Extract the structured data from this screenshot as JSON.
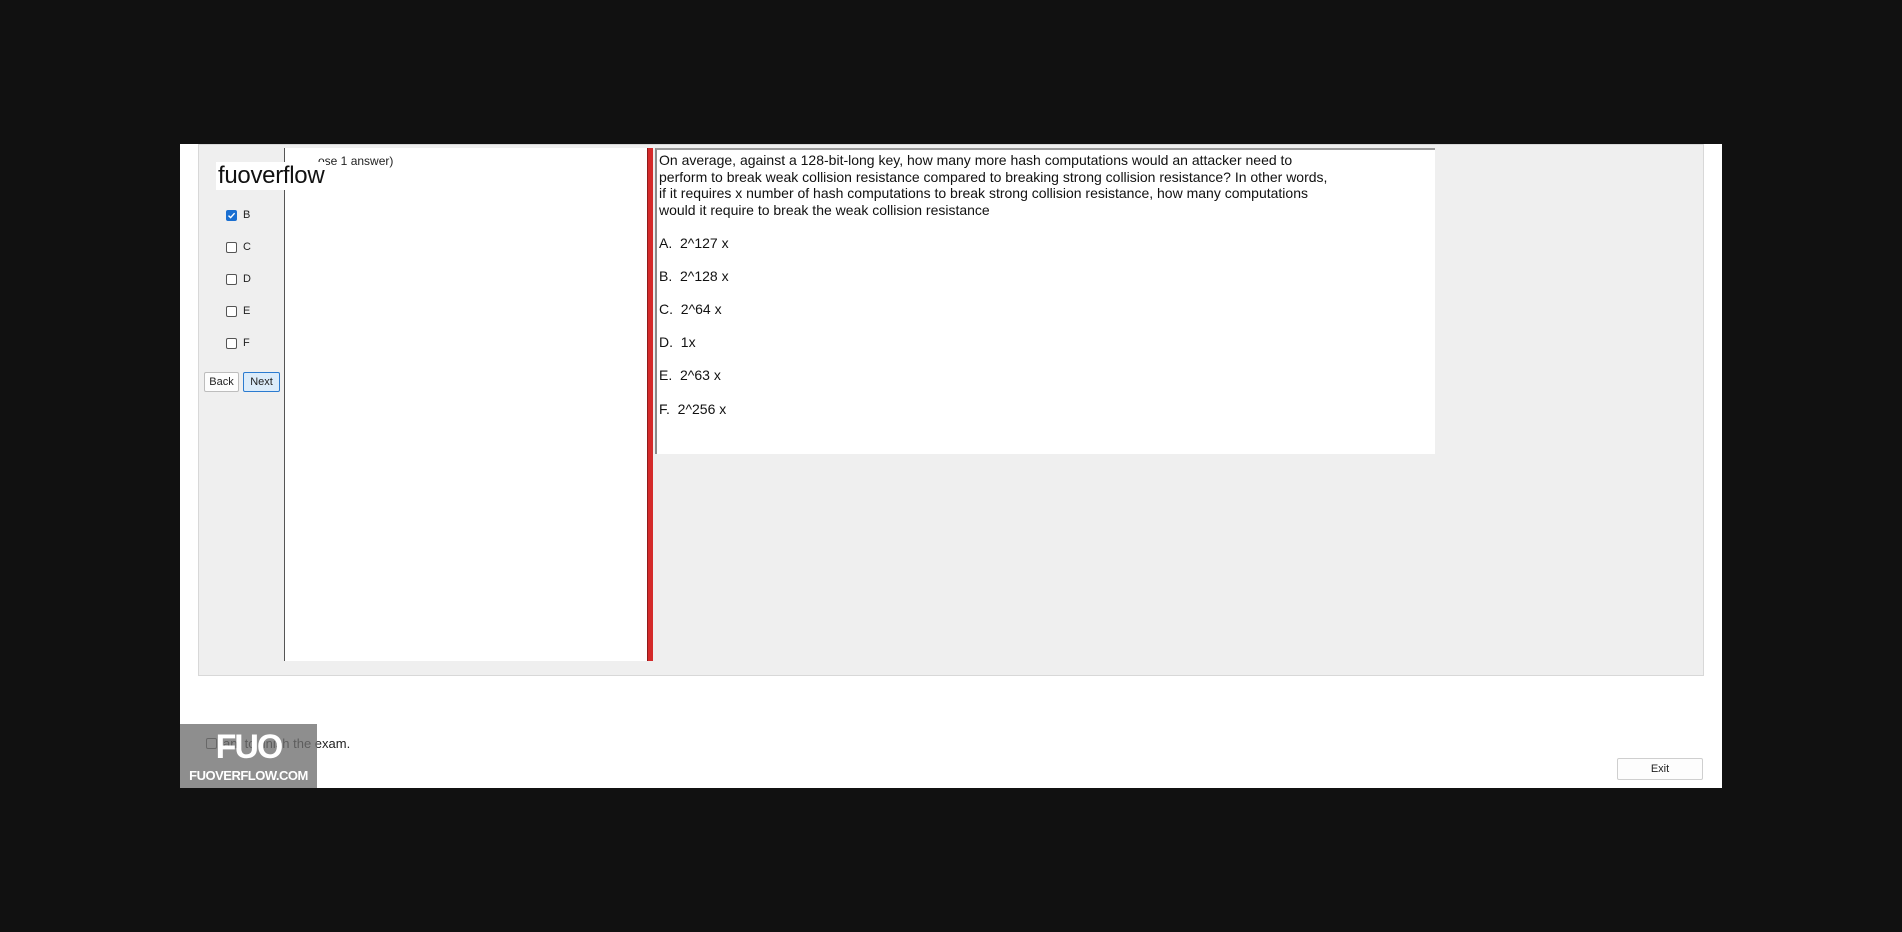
{
  "brand": {
    "title": "fuoverflow"
  },
  "sidebar": {
    "answers": [
      {
        "label": "B",
        "checked": true
      },
      {
        "label": "C",
        "checked": false
      },
      {
        "label": "D",
        "checked": false
      },
      {
        "label": "E",
        "checked": false
      },
      {
        "label": "F",
        "checked": false
      }
    ],
    "back_label": "Back",
    "next_label": "Next"
  },
  "left_panel": {
    "instruction": "ose 1 answer)"
  },
  "question": {
    "line1": "On average, against a 128-bit-long key, how many more hash computations would an attacker need to",
    "line2": "perform to break weak collision resistance compared to breaking strong collision resistance? In other words,",
    "line3": "if it requires x number of hash computations to break strong collision resistance, how many computations",
    "line4": "would it require to break the weak collision resistance",
    "options": [
      {
        "text": "A.  2^127 x"
      },
      {
        "text": "B.  2^128 x"
      },
      {
        "text": "C.  2^64 x"
      },
      {
        "text": "D.  1x"
      },
      {
        "text": "E.  2^63 x"
      },
      {
        "text": "F.  2^256 x"
      }
    ]
  },
  "footer": {
    "finish_text": "ant to finish the exam.",
    "exit_label": "Exit"
  },
  "watermark": {
    "logo": "FUO",
    "site": "FUOVERFLOW.COM"
  },
  "colors": {
    "splitter": "#d42a2a",
    "checkbox_checked": "#1a6fd1",
    "next_button_border": "#2b7bd0"
  }
}
